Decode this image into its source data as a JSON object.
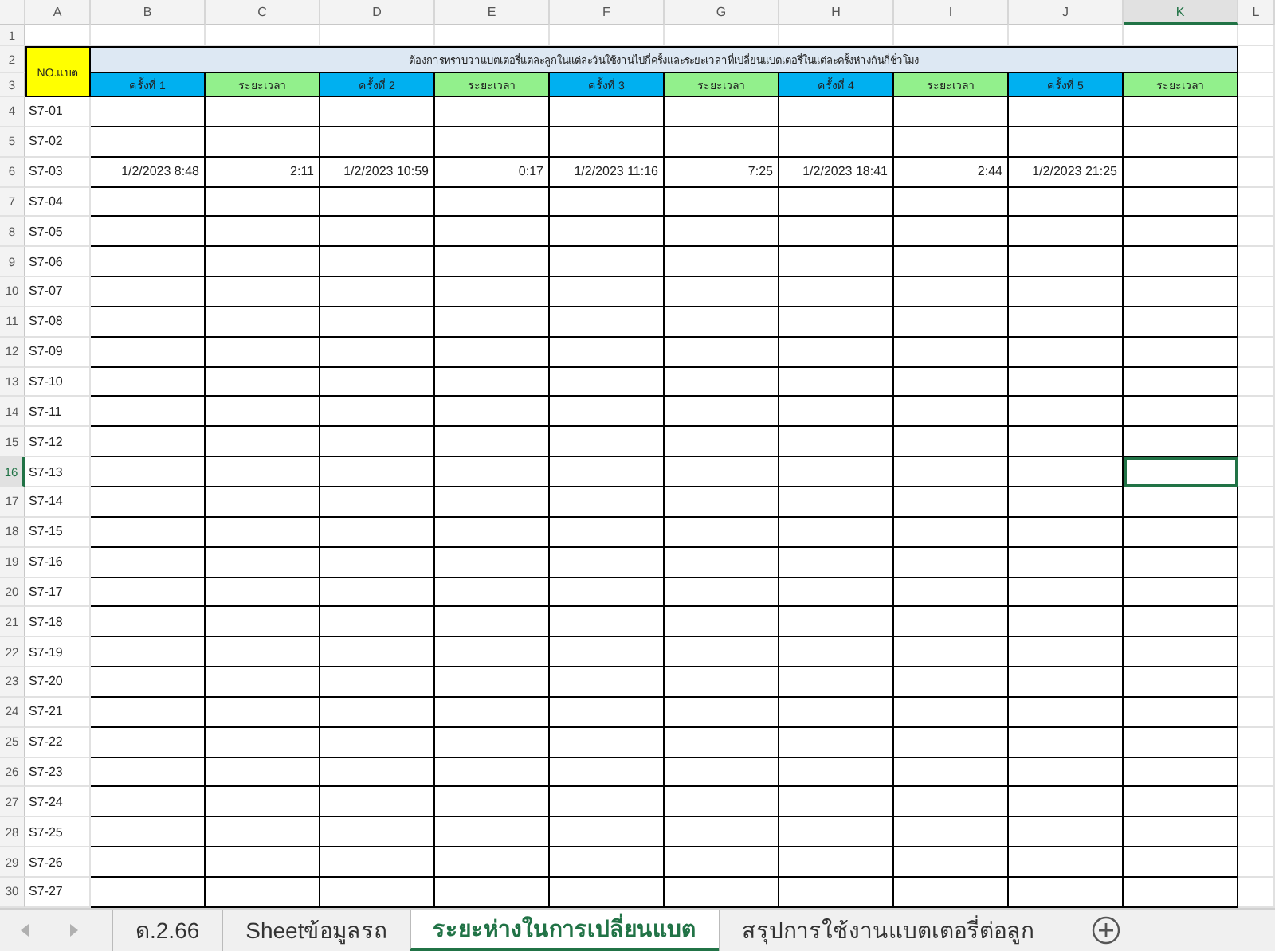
{
  "columns": [
    {
      "letter": "A",
      "selected": false
    },
    {
      "letter": "B",
      "selected": false
    },
    {
      "letter": "C",
      "selected": false
    },
    {
      "letter": "D",
      "selected": false
    },
    {
      "letter": "E",
      "selected": false
    },
    {
      "letter": "F",
      "selected": false
    },
    {
      "letter": "G",
      "selected": false
    },
    {
      "letter": "H",
      "selected": false
    },
    {
      "letter": "I",
      "selected": false
    },
    {
      "letter": "J",
      "selected": false
    },
    {
      "letter": "K",
      "selected": true
    },
    {
      "letter": "L",
      "selected": false
    }
  ],
  "header_rows": {
    "row_numbers": [
      "1",
      "2",
      "3"
    ],
    "key_header": "NO.แบต",
    "title": "ต้องการทราบว่าแบตเตอรี่แต่ละลูกในแต่ละวันใช้งานไปกี่ครั้งและระยะเวลาที่เปลี่ยนแบตเตอรี่ในแต่ละครั้งห่างกันกี่ชั่วโมง",
    "headings": [
      {
        "kind": "count",
        "text": "ครั้งที่ 1"
      },
      {
        "kind": "duration",
        "text": "ระยะเวลา"
      },
      {
        "kind": "count",
        "text": "ครั้งที่ 2"
      },
      {
        "kind": "duration",
        "text": "ระยะเวลา"
      },
      {
        "kind": "count",
        "text": "ครั้งที่ 3"
      },
      {
        "kind": "duration",
        "text": "ระยะเวลา"
      },
      {
        "kind": "count",
        "text": "ครั้งที่ 4"
      },
      {
        "kind": "duration",
        "text": "ระยะเวลา"
      },
      {
        "kind": "count",
        "text": "ครั้งที่ 5"
      },
      {
        "kind": "duration",
        "text": "ระยะเวลา"
      }
    ]
  },
  "rows": [
    {
      "number": "4",
      "label": "S7-01",
      "selected": false
    },
    {
      "number": "5",
      "label": "S7-02",
      "selected": false
    },
    {
      "number": "6",
      "label": "S7-03",
      "selected": false,
      "values": [
        "1/2/2023 8:48",
        "2:11",
        "1/2/2023 10:59",
        "0:17",
        "1/2/2023 11:16",
        "7:25",
        "1/2/2023 18:41",
        "2:44",
        "1/2/2023 21:25"
      ]
    },
    {
      "number": "7",
      "label": "S7-04",
      "selected": false
    },
    {
      "number": "8",
      "label": "S7-05",
      "selected": false
    },
    {
      "number": "9",
      "label": "S7-06",
      "selected": false
    },
    {
      "number": "10",
      "label": "S7-07",
      "selected": false
    },
    {
      "number": "11",
      "label": "S7-08",
      "selected": false
    },
    {
      "number": "12",
      "label": "S7-09",
      "selected": false
    },
    {
      "number": "13",
      "label": "S7-10",
      "selected": false
    },
    {
      "number": "14",
      "label": "S7-11",
      "selected": false
    },
    {
      "number": "15",
      "label": "S7-12",
      "selected": false
    },
    {
      "number": "16",
      "label": "S7-13",
      "selected": true
    },
    {
      "number": "17",
      "label": "S7-14",
      "selected": false
    },
    {
      "number": "18",
      "label": "S7-15",
      "selected": false
    },
    {
      "number": "19",
      "label": "S7-16",
      "selected": false
    },
    {
      "number": "20",
      "label": "S7-17",
      "selected": false
    },
    {
      "number": "21",
      "label": "S7-18",
      "selected": false
    },
    {
      "number": "22",
      "label": "S7-19",
      "selected": false
    },
    {
      "number": "23",
      "label": "S7-20",
      "selected": false
    },
    {
      "number": "24",
      "label": "S7-21",
      "selected": false
    },
    {
      "number": "25",
      "label": "S7-22",
      "selected": false
    },
    {
      "number": "26",
      "label": "S7-23",
      "selected": false
    },
    {
      "number": "27",
      "label": "S7-24",
      "selected": false
    },
    {
      "number": "28",
      "label": "S7-25",
      "selected": false
    },
    {
      "number": "29",
      "label": "S7-26",
      "selected": false
    },
    {
      "number": "30",
      "label": "S7-27",
      "selected": false
    }
  ],
  "sheet_tabs": [
    {
      "label": "ด.2.66",
      "selected": false
    },
    {
      "label": "Sheetข้อมูลรถ",
      "selected": false
    },
    {
      "label": "ระยะห่างในการเปลี่ยนแบต",
      "selected": true
    },
    {
      "label": "สรุปการใช้งานแบตเตอรี่ต่อลูก",
      "selected": false
    }
  ]
}
